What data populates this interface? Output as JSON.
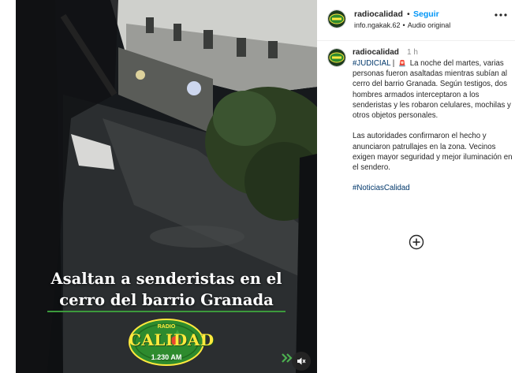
{
  "post": {
    "headline_line1": "Asaltan a senderistas en el",
    "headline_line2": "cerro del barrio Granada",
    "logo": {
      "radio": "RADIO",
      "name": "CALIDAD",
      "frequency": "1.230 AM"
    },
    "controls": {
      "next_icon": "double-chevron-right-icon",
      "mute_icon": "speaker-muted-icon"
    }
  },
  "header": {
    "username": "radiocalidad",
    "separator": "•",
    "follow_label": "Seguir",
    "account_tag": "info.ngakak.62",
    "audio_label": "Audio original",
    "more_icon": "more-options-icon"
  },
  "caption": {
    "username": "radiocalidad",
    "time": "1 h",
    "hashtag_top": "#JUDICIAL",
    "pipe": "|",
    "siren": "🚨",
    "paragraph1": "La noche del martes, varias personas fueron asaltadas mientras subían al cerro del barrio Granada. Según testigos, dos hombres armados interceptaron a los senderistas y les robaron celulares, mochilas y otros objetos personales.",
    "paragraph2": "Las autoridades confirmaron el hecho y anunciaron patrullajes en la zona. Vecinos exigen mayor seguridad y mejor iluminación en el sendero.",
    "hashtag_bottom": "#NoticiasCalidad"
  },
  "colors": {
    "link_blue": "#0095f6",
    "hashtag": "#00376b",
    "logo_green": "#2e8b2e",
    "logo_yellow": "#ffe93d"
  }
}
